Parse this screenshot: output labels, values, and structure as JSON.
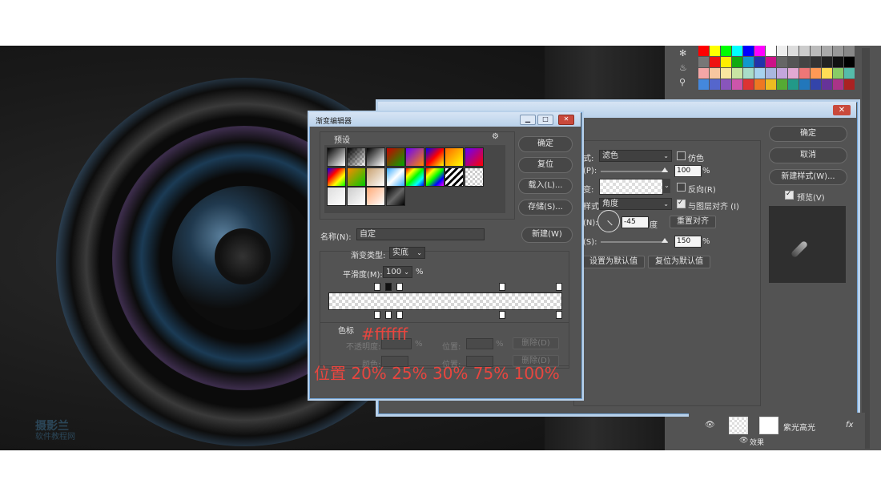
{
  "gradient_editor": {
    "title": "渐变编辑器",
    "presets_label": "预设",
    "buttons": {
      "ok": "确定",
      "reset": "复位",
      "load": "载入(L)...",
      "save": "存储(S)...",
      "new": "新建(W)"
    },
    "name_label": "名称(N):",
    "name_value": "自定",
    "type_label": "渐变类型:",
    "type_value": "实底",
    "smoothness_label": "平滑度(M):",
    "smoothness_value": "100",
    "smoothness_unit": "%",
    "stops_group_label": "色标",
    "opacity_label": "不透明度:",
    "position_label": "位置:",
    "pct": "%",
    "delete_label": "删除(D)",
    "color_label": "颜色:",
    "opacity_stop_positions": [
      20,
      25,
      30,
      75,
      100
    ],
    "color_stop_positions": [
      20,
      25,
      30,
      75,
      100
    ]
  },
  "layer_style": {
    "mode_label": "式:",
    "mode_value": "滤色",
    "dither_label": "仿色",
    "opacity_label": "(P):",
    "opacity_value": "100",
    "pct": "%",
    "gradient_label": "变:",
    "reverse_label": "反向(R)",
    "style_label": "样式:",
    "style_value": "角度",
    "align_label": "与图层对齐 (I)",
    "angle_label": "(N):",
    "angle_value": "-45",
    "degree_label": "度",
    "reset_align": "重置对齐",
    "scale_label": "(S):",
    "scale_value": "150",
    "set_default": "设置为默认值",
    "reset_default": "复位为默认值",
    "ok": "确定",
    "cancel": "取消",
    "new_style": "新建样式(W)...",
    "preview_label": "预览(V)",
    "close_glyph": "✕"
  },
  "layers": {
    "layer_name": "紫光高光",
    "fx_label": "fx",
    "effects_label": "效果"
  },
  "watermark": {
    "line1": "摄影兰",
    "line2": "软件教程网"
  },
  "annotations": {
    "color_text": "#ffffff",
    "positions_text": "位置 20% 25% 30% 75% 100%"
  },
  "swatches": [
    "#ff0000",
    "#ffff00",
    "#00ff00",
    "#00ffff",
    "#0000ff",
    "#ff00ff",
    "#ffffff",
    "#eeeeee",
    "#dddddd",
    "#cccccc",
    "#bbbbbb",
    "#aaaaaa",
    "#999999",
    "#888888",
    "#777777",
    "#ee1111",
    "#ffee00",
    "#11aa11",
    "#1199cc",
    "#2233aa",
    "#cc1188",
    "#666666",
    "#555555",
    "#444444",
    "#333333",
    "#222222",
    "#111111",
    "#000000",
    "#f4a6a6",
    "#f6c6a0",
    "#f9e79f",
    "#c9e5a3",
    "#a9dcc8",
    "#a7d3ee",
    "#a9b7e0",
    "#c4a6dd",
    "#e2a9d3",
    "#ee7777",
    "#ff9955",
    "#ffdd55",
    "#88cc66",
    "#55bbaa",
    "#4488dd",
    "#5566cc",
    "#8855bb",
    "#cc55aa",
    "#dd3333",
    "#ee7722",
    "#eebb22",
    "#55aa33",
    "#229988",
    "#2277bb",
    "#3344aa",
    "#663399",
    "#aa3388",
    "#aa2222"
  ]
}
